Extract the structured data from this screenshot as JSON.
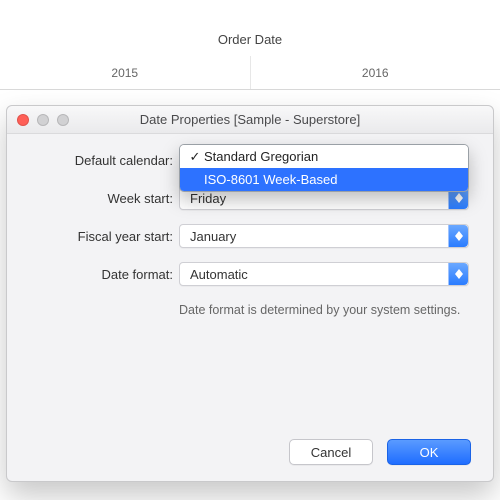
{
  "background": {
    "column_title": "Order Date",
    "years": [
      "2015",
      "2016"
    ]
  },
  "dialog": {
    "title": "Date Properties [Sample - Superstore]",
    "defaultCalendar": {
      "label": "Default calendar:",
      "value": "Standard Gregorian",
      "options": [
        "Standard Gregorian",
        "ISO-8601 Week-Based"
      ]
    },
    "weekStart": {
      "label": "Week start:",
      "value": "Friday"
    },
    "fiscalYearStart": {
      "label": "Fiscal year start:",
      "value": "January"
    },
    "dateFormat": {
      "label": "Date format:",
      "value": "Automatic",
      "help": "Date format is determined by your system settings."
    },
    "buttons": {
      "cancel": "Cancel",
      "ok": "OK"
    }
  }
}
